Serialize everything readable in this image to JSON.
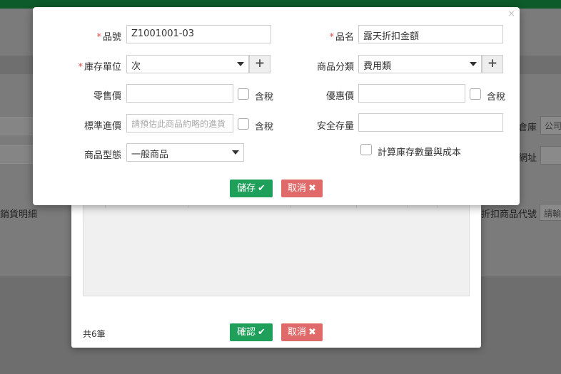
{
  "background": {
    "warehouse_label": "倉庫",
    "warehouse_value": "公司",
    "address_label": "網址",
    "detail_label": "銷貨明細",
    "discount_code_label": "折扣商品代號",
    "discount_code_placeholder": "請輸"
  },
  "form": {
    "item_no": {
      "label": "品號",
      "value": "Z1001001-03"
    },
    "item_name": {
      "label": "品名",
      "value": "露天折扣金額"
    },
    "stock_unit": {
      "label": "庫存單位",
      "value": "次",
      "add_label": "+"
    },
    "category": {
      "label": "商品分類",
      "value": "費用類",
      "add_label": "+"
    },
    "retail_price": {
      "label": "零售價",
      "value": "",
      "tax_label": "含稅"
    },
    "discount_price": {
      "label": "優惠價",
      "value": "",
      "tax_label": "含稅"
    },
    "std_cost": {
      "label": "標準進價",
      "placeholder": "請預估此商品約略的進貨",
      "tax_label": "含稅"
    },
    "safety_stock": {
      "label": "安全存量",
      "value": ""
    },
    "product_type": {
      "label": "商品型態",
      "value": "一般商品"
    },
    "calc_stock_label": "計算庫存數量與成本",
    "save_label": "儲存",
    "cancel_label": "取消"
  },
  "lower_dialog": {
    "count_text": "共6筆",
    "confirm_label": "確認",
    "cancel_label": "取消"
  },
  "icons": {
    "close": "close-icon",
    "check": "check-icon",
    "cross": "cross-icon",
    "plus": "plus-icon",
    "caret": "chevron-down-icon"
  },
  "colors": {
    "topbar": "#0d5a2a",
    "primary": "#1fa05a",
    "danger": "#e06a6a",
    "required": "#e04b4b"
  }
}
